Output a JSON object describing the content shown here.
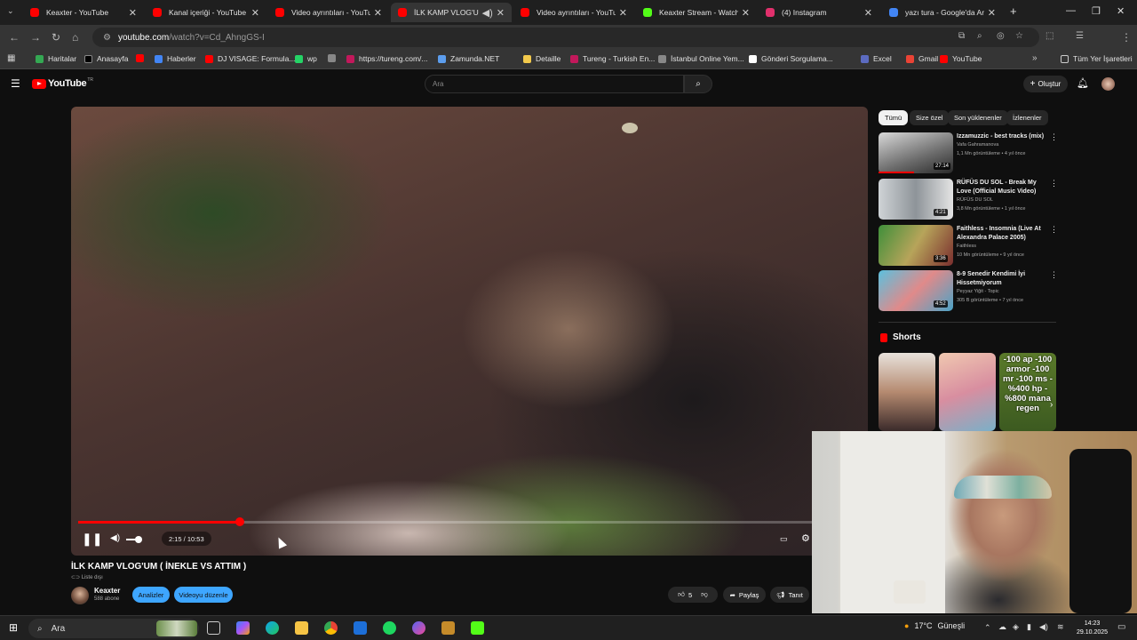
{
  "browser": {
    "tabs": [
      {
        "title": "Keaxter - YouTube",
        "fav_color": "#ff0000"
      },
      {
        "title": "Kanal içeriği - YouTube St",
        "fav_color": "#ff0000"
      },
      {
        "title": "Video ayrıntıları - YouTub",
        "fav_color": "#ff0000"
      },
      {
        "title": "İLK KAMP VLOG'UM (",
        "fav_color": "#ff0000"
      },
      {
        "title": "Video ayrıntıları - YouTub",
        "fav_color": "#ff0000"
      },
      {
        "title": "Keaxter Stream - Watch L",
        "fav_color": "#53fc18"
      },
      {
        "title": "(4) Instagram",
        "fav_color": "#e1306c"
      },
      {
        "title": "yazı tura - Google'da Ara",
        "fav_color": "#4285f4"
      }
    ],
    "url_host": "youtube.com",
    "url_rest": "/watch?v=Cd_AhngGS-I",
    "bookmarks": [
      {
        "label": "Haritalar",
        "color": "#34a853"
      },
      {
        "label": "Anasayfa",
        "color": "#000000"
      },
      {
        "label": "",
        "color": "#ff0000"
      },
      {
        "label": "Haberler",
        "color": "#4285f4"
      },
      {
        "label": "DJ VISAGE: Formula...",
        "color": "#ff0000"
      },
      {
        "label": "wp",
        "color": "#25d366"
      },
      {
        "label": "",
        "color": "#888888"
      },
      {
        "label": "https://tureng.com/...",
        "color": "#c2185b"
      },
      {
        "label": "Zamunda.NET",
        "color": "#5c9ded"
      },
      {
        "label": "Detaille",
        "color": "#f2c94c"
      },
      {
        "label": "Tureng - Turkish En...",
        "color": "#c2185b"
      },
      {
        "label": "İstanbul Online Yem...",
        "color": "#888888"
      },
      {
        "label": "Gönderi Sorgulama...",
        "color": "#ffffff"
      },
      {
        "label": "Excel",
        "color": "#5c6bc0"
      },
      {
        "label": "Gmail",
        "color": "#ea4335"
      },
      {
        "label": "YouTube",
        "color": "#ff0000"
      }
    ],
    "all_bookmarks": "Tüm Yer İşaretleri"
  },
  "youtube": {
    "logo_text": "YouTube",
    "logo_country": "TR",
    "search_placeholder": "Ara",
    "create_label": "Oluştur"
  },
  "player": {
    "time": "2:15 / 10:53",
    "progress_fraction": 0.207
  },
  "video": {
    "title": "İLK KAMP VLOG'UM ( İNEKLE VS ATTIM )",
    "visibility": "Liste dışı",
    "channel": "Keaxter",
    "subscribers": "588 abone",
    "analytics_btn": "Analizler",
    "edit_btn": "Videoyu düzenle",
    "likes": "5",
    "share_btn": "Paylaş",
    "promote_btn": "Tanıt"
  },
  "chips": [
    "Tümü",
    "Size özel",
    "Son yüklenenler",
    "İzlenenler"
  ],
  "recommendations": [
    {
      "title": "Izzamuzzic - best tracks (mix)",
      "channel": "Vafa Gahramanova",
      "views": "1,1 Mn görüntüleme • 4 yıl önce",
      "duration": "27:14",
      "thumb": "linear-gradient(160deg,#d9d9d9,#6b6b6b 60%,#2a2a2a)"
    },
    {
      "title": "RÜFÜS DU SOL - Break My Love (Official Music Video)",
      "channel": "RÜFÜS DU SOL",
      "views": "3,8 Mn görüntüleme • 1 yıl önce",
      "duration": "4:21",
      "thumb": "linear-gradient(90deg,#cfd3d6,#8e9499 50%,#e4e4e4)"
    },
    {
      "title": "Faithless - Insomnia (Live At Alexandra Palace 2005)",
      "channel": "Faithless",
      "views": "10 Mn görüntüleme • 9 yıl önce",
      "duration": "3:36",
      "thumb": "linear-gradient(120deg,#3f8f3a,#b7a45a 50%,#7a2e2e)"
    },
    {
      "title": "8-9 Senedir Kendimi İyi Hissetmiyorum",
      "channel": "Peyyaz Yiğit - Topic",
      "views": "305 B görüntüleme • 7 yıl önce",
      "duration": "4:52",
      "thumb": "linear-gradient(135deg,#5bc0de,#e08a8a 50%,#4aa3c7)"
    }
  ],
  "shorts": {
    "heading": "Shorts",
    "items": [
      {
        "bg": "linear-gradient(180deg,#e8e2dc,#b58a70 50%,#3a2a2a)",
        "text": ""
      },
      {
        "bg": "linear-gradient(160deg,#f0c8b0,#d88ea0 50%,#7ab0c8)",
        "text": ""
      },
      {
        "bg": "linear-gradient(180deg,#5a7a2a,#3c5a20)",
        "text": "-100 ap -100 armor -100 mr -100 ms -%400 hp -%800 mana regen"
      }
    ]
  },
  "taskbar": {
    "search": "Ara",
    "temperature": "17°C",
    "weather": "Güneşli",
    "time": "14:23",
    "date": "29.10.2025"
  }
}
